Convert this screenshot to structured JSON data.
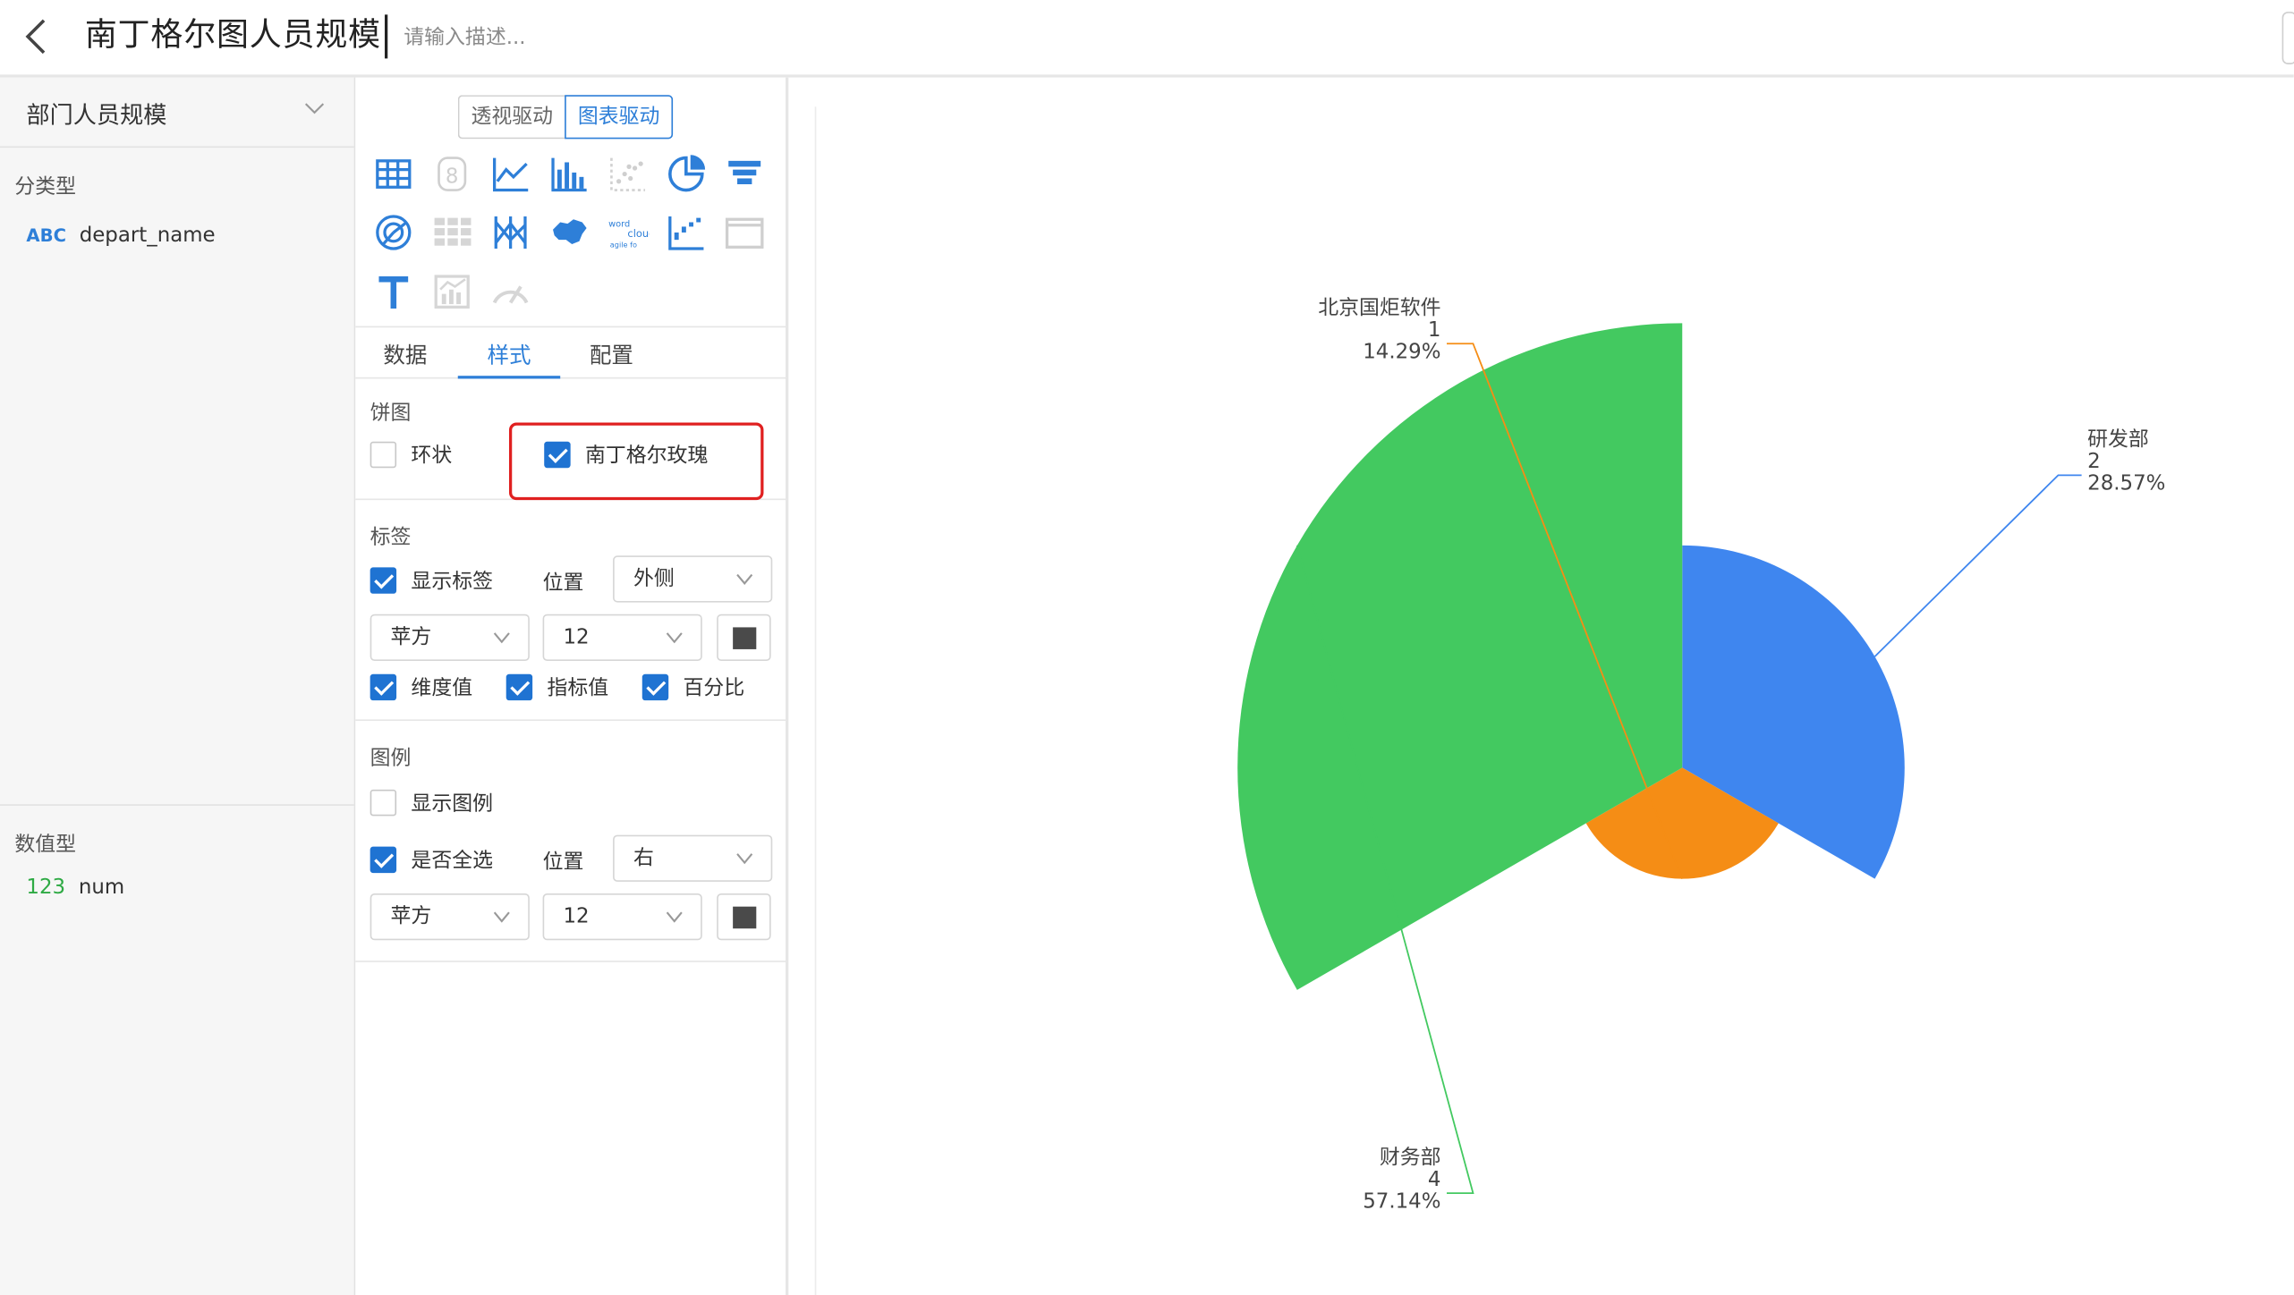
{
  "header": {
    "title": "南丁格尔图人员规模",
    "desc_placeholder": "请输入描述..."
  },
  "fields_panel": {
    "dataset": "部门人员规模",
    "dimension_group": "分类型",
    "dimension_field": {
      "type_tag": "ABC",
      "name": "depart_name"
    },
    "measure_group": "数值型",
    "measure_field": {
      "type_tag": "123",
      "name": "num"
    }
  },
  "config_panel": {
    "mode_tabs": [
      "透视驱动",
      "图表驱动"
    ],
    "selected_mode": "图表驱动",
    "chart_types": [
      "table-icon",
      "number-icon",
      "line-chart-icon",
      "bar-chart-icon",
      "scatter-icon",
      "pie-chart-icon",
      "funnel-icon",
      "radar-icon",
      "heatmap-icon",
      "parallel-icon",
      "china-map-icon",
      "wordcloud-icon",
      "waterfall-icon",
      "frame-icon",
      "text-icon",
      "combo-icon",
      "gauge-icon"
    ],
    "selected_chart": "pie-chart-icon",
    "tabs": [
      "数据",
      "样式",
      "配置"
    ],
    "active_tab": "样式",
    "pie": {
      "title": "饼图",
      "ring_label": "环状",
      "ring_checked": false,
      "rose_label": "南丁格尔玫瑰",
      "rose_checked": true
    },
    "label": {
      "title": "标签",
      "show_label": "显示标签",
      "show_checked": true,
      "position_label": "位置",
      "position_value": "外侧",
      "font_value": "苹方",
      "size_value": "12",
      "dimension_label": "维度值",
      "metric_label": "指标值",
      "percent_label": "百分比"
    },
    "legend": {
      "title": "图例",
      "show_label": "显示图例",
      "show_checked": false,
      "select_all_label": "是否全选",
      "select_all_checked": true,
      "position_label": "位置",
      "position_value": "右",
      "font_value": "苹方",
      "size_value": "12"
    }
  },
  "colors": {
    "accent": "#1f73d2",
    "highlight": "#e02020"
  },
  "chart_data": {
    "type": "pie",
    "variant": "nightingale-rose",
    "categories": [
      "研发部",
      "北京国炬软件",
      "财务部"
    ],
    "values": [
      2,
      1,
      4
    ],
    "percents": [
      "28.57%",
      "14.29%",
      "57.14%"
    ],
    "colors": [
      "#3f86ef",
      "#f58d15",
      "#43c960"
    ],
    "label_position": "outside",
    "legend": false
  }
}
